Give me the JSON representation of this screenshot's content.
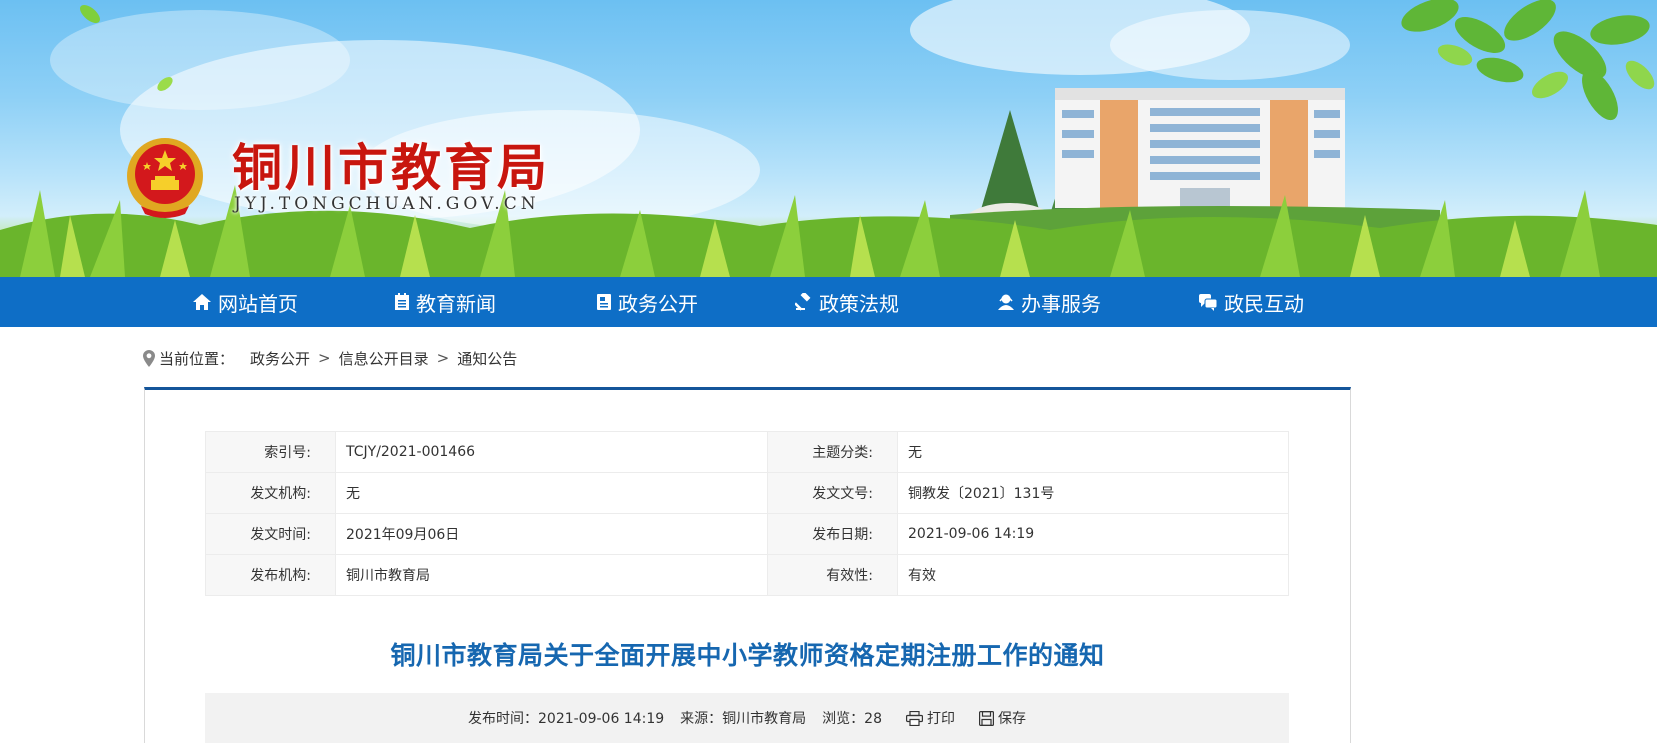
{
  "header": {
    "title": "铜川市教育局",
    "domain": "JYJ.TONGCHUAN.GOV.CN"
  },
  "nav": {
    "items": [
      {
        "label": "网站首页",
        "icon": "home-icon"
      },
      {
        "label": "教育新闻",
        "icon": "news-icon"
      },
      {
        "label": "政务公开",
        "icon": "document-icon"
      },
      {
        "label": "政策法规",
        "icon": "gavel-icon"
      },
      {
        "label": "办事服务",
        "icon": "service-icon"
      },
      {
        "label": "政民互动",
        "icon": "chat-icon"
      }
    ]
  },
  "breadcrumb": {
    "label": "当前位置：",
    "items": [
      "政务公开",
      "信息公开目录",
      "通知公告"
    ],
    "separator": ">"
  },
  "meta": {
    "rows": [
      {
        "k1": "索引号:",
        "v1": "TCJY/2021-001466",
        "k2": "主题分类:",
        "v2": "无"
      },
      {
        "k1": "发文机构:",
        "v1": "无",
        "k2": "发文文号:",
        "v2": "铜教发〔2021〕131号"
      },
      {
        "k1": "发文时间:",
        "v1": "2021年09月06日",
        "k2": "发布日期:",
        "v2": "2021-09-06 14:19"
      },
      {
        "k1": "发布机构:",
        "v1": "铜川市教育局",
        "k2": "有效性:",
        "v2": "有效"
      }
    ]
  },
  "article": {
    "title": "铜川市教育局关于全面开展中小学教师资格定期注册工作的通知"
  },
  "info_bar": {
    "publish_time": "发布时间：2021-09-06 14:19",
    "source": "来源：铜川市教育局",
    "views": "浏览：28",
    "print_label": "打印",
    "save_label": "保存"
  },
  "colors": {
    "nav_bg": "#0e6ec6",
    "title_red": "#c8160e",
    "article_title_blue": "#1667b0",
    "panel_top_border": "#14559a"
  }
}
